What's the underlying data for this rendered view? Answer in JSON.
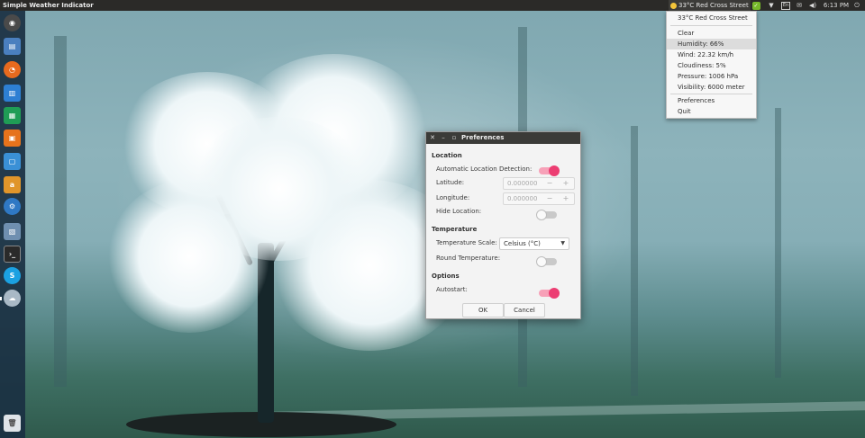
{
  "topbar": {
    "app_title": "Simple Weather Indicator",
    "indicator_text": "33°C  Red Cross Street",
    "tray": {
      "keyboard": "En",
      "time": "6:13 PM"
    }
  },
  "menu": {
    "items": [
      "33°C  Red Cross Street",
      "Clear",
      "Humidity: 66%",
      "Wind: 22.32 km/h",
      "Cloudiness: 5%",
      "Pressure: 1006 hPa",
      "Visibility: 6000 meter",
      "Preferences",
      "Quit"
    ],
    "highlighted": "Humidity: 66%"
  },
  "preferences": {
    "title": "Preferences",
    "location_header": "Location",
    "auto_location_label": "Automatic Location Detection:",
    "auto_location": true,
    "latitude_label": "Latitude:",
    "latitude_value": "0.000000",
    "longitude_label": "Longitude:",
    "longitude_value": "0.000000",
    "hide_location_label": "Hide Location:",
    "hide_location": false,
    "temperature_header": "Temperature",
    "scale_label": "Temperature Scale:",
    "scale_value": "Celsius (°C)",
    "round_label": "Round Temperature:",
    "round": false,
    "options_header": "Options",
    "autostart_label": "Autostart:",
    "autostart": true,
    "ok_label": "OK",
    "cancel_label": "Cancel",
    "minus": "−",
    "plus": "+"
  },
  "launcher": {
    "icons": [
      "ubuntu-dash-icon",
      "files-icon",
      "firefox-icon",
      "docs-icon",
      "spreadsheet-icon",
      "presentation-icon",
      "software-center-icon",
      "amazon-icon",
      "system-settings-icon",
      "image-viewer-icon",
      "terminal-icon",
      "skype-icon",
      "weather-icon",
      "trash-icon"
    ]
  },
  "colors": {
    "accent_pink": "#ec3d72",
    "panel": "#2b2a28",
    "launcher": "#1a3042"
  }
}
